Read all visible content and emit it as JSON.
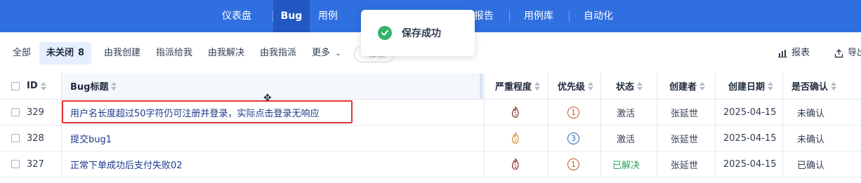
{
  "topnav": {
    "items": [
      {
        "label": "仪表盘"
      },
      {
        "label": "Bug"
      },
      {
        "label": "用例"
      },
      {
        "label": "报告"
      },
      {
        "label": "用例库"
      },
      {
        "label": "自动化"
      }
    ],
    "active": "Bug",
    "color": "#2f6fe0"
  },
  "toast": {
    "message": "保存成功",
    "icon": "check-circle-icon",
    "color": "#34b36b"
  },
  "filters": {
    "all": "全部",
    "unclosed": "未关闭",
    "unclosed_count": "8",
    "created_by_me": "由我创建",
    "assigned_to_me": "指派给我",
    "resolved_by_me": "由我解决",
    "assigned_by_me": "由我指派",
    "more": "更多",
    "search": "搜索"
  },
  "tools": {
    "report": "报表",
    "export": "导出"
  },
  "table": {
    "columns": {
      "id": "ID",
      "title": "Bug标题",
      "severity": "严重程度",
      "priority": "优先级",
      "status": "状态",
      "creator": "创建者",
      "created_date": "创建日期",
      "confirmed": "是否确认"
    },
    "rows": [
      {
        "id": "329",
        "title": "用户名长度超过50字符仍可注册并登录，实际点击登录无响应",
        "severity": "1",
        "priority": "1",
        "status": "激活",
        "creator": "张延世",
        "created_date": "2025-04-15",
        "confirmed": "未确认"
      },
      {
        "id": "328",
        "title": "提交bug1",
        "severity": "2",
        "priority": "3",
        "status": "激活",
        "creator": "张延世",
        "created_date": "2025-04-15",
        "confirmed": "未确认"
      },
      {
        "id": "327",
        "title": "正常下单成功后支付失败02",
        "severity": "1",
        "priority": "1",
        "status": "已解决",
        "creator": "张延世",
        "created_date": "2025-04-15",
        "confirmed": "已确认"
      }
    ]
  }
}
